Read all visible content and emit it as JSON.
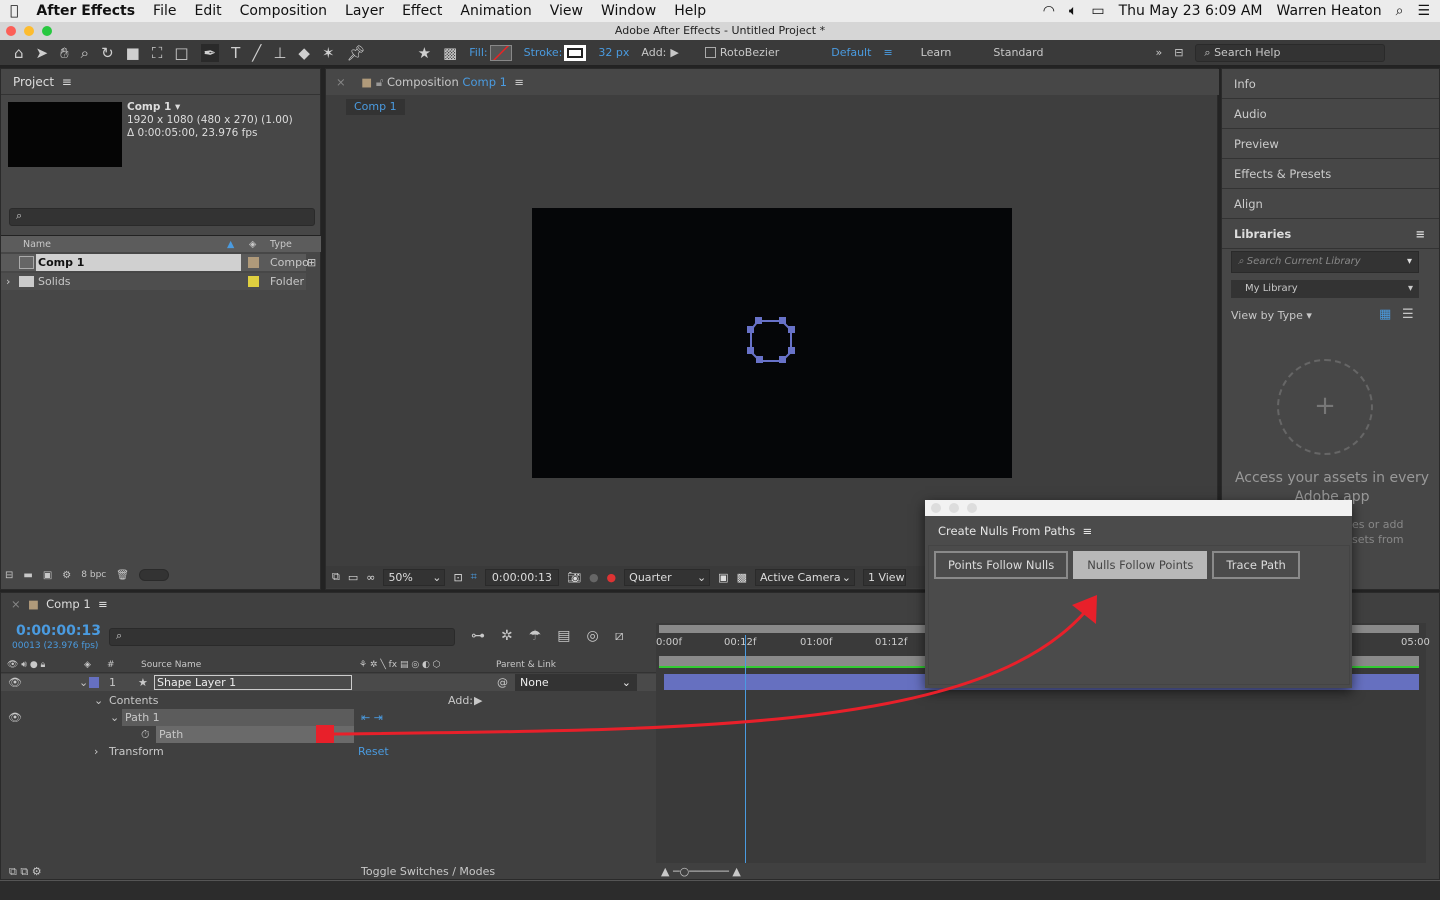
{
  "menubar": {
    "apple": "",
    "app": "After Effects",
    "items": [
      "File",
      "Edit",
      "Composition",
      "Layer",
      "Effect",
      "Animation",
      "View",
      "Window",
      "Help"
    ],
    "clock": "Thu May 23  6:09 AM",
    "user": "Warren Heaton"
  },
  "window_title": "Adobe After Effects - Untitled Project *",
  "toolbar": {
    "fill_label": "Fill:",
    "stroke_label": "Stroke:",
    "stroke_width": "32 px",
    "add_label": "Add:",
    "rotobezier": "RotoBezier",
    "workspaces": [
      "Default",
      "Learn",
      "Standard"
    ],
    "search_help": "Search Help"
  },
  "project": {
    "title": "Project",
    "comp_name": "Comp 1 ▾",
    "comp_res": "1920 x 1080  (480 x 270) (1.00)",
    "comp_duration": "Δ 0:00:05:00, 23.976 fps",
    "col_name": "Name",
    "col_type": "Type",
    "items": [
      {
        "name": "Comp 1",
        "type": "Compo",
        "color": "#b09a7a"
      },
      {
        "name": "Solids",
        "type": "Folder",
        "color": "#e0d040"
      }
    ],
    "bpc": "8 bpc"
  },
  "composition": {
    "tab_title": "Composition",
    "tab_comp": "Comp 1",
    "breadcrumb": "Comp 1",
    "zoom": "50%",
    "timecode": "0:00:00:13",
    "resolution": "Quarter",
    "camera": "Active Camera",
    "views": "1 View"
  },
  "right_panel": {
    "items": [
      "Info",
      "Audio",
      "Preview",
      "Effects & Presets",
      "Align"
    ],
    "libraries": "Libraries",
    "search_placeholder": "Search Current Library",
    "library": "My Library",
    "view_by": "View by Type",
    "assets_text": "Access your assets in every Adobe app",
    "assets_sub": "es or add\nsets from"
  },
  "dialog": {
    "title": "Create Nulls From Paths",
    "buttons": [
      "Points Follow Nulls",
      "Nulls Follow Points",
      "Trace Path"
    ],
    "active": "Nulls Follow Points"
  },
  "timeline": {
    "tab": "Comp 1",
    "timecode": "0:00:00:13",
    "frames": "00013 (23.976 fps)",
    "col_source": "Source Name",
    "col_parent": "Parent & Link",
    "col_num": "#",
    "layer_num": "1",
    "layer_name": "Shape Layer 1",
    "parent": "None",
    "contents": "Contents",
    "add": "Add:",
    "path_group": "Path 1",
    "path": "Path",
    "transform": "Transform",
    "reset": "Reset",
    "ruler": [
      "0:00f",
      "00:12f",
      "01:00f",
      "01:12f",
      "05:00"
    ],
    "toggle": "Toggle Switches / Modes"
  },
  "colors": {
    "accent": "#4a9be0",
    "annotation": "#e8202a",
    "layer_label": "#6670c0"
  }
}
